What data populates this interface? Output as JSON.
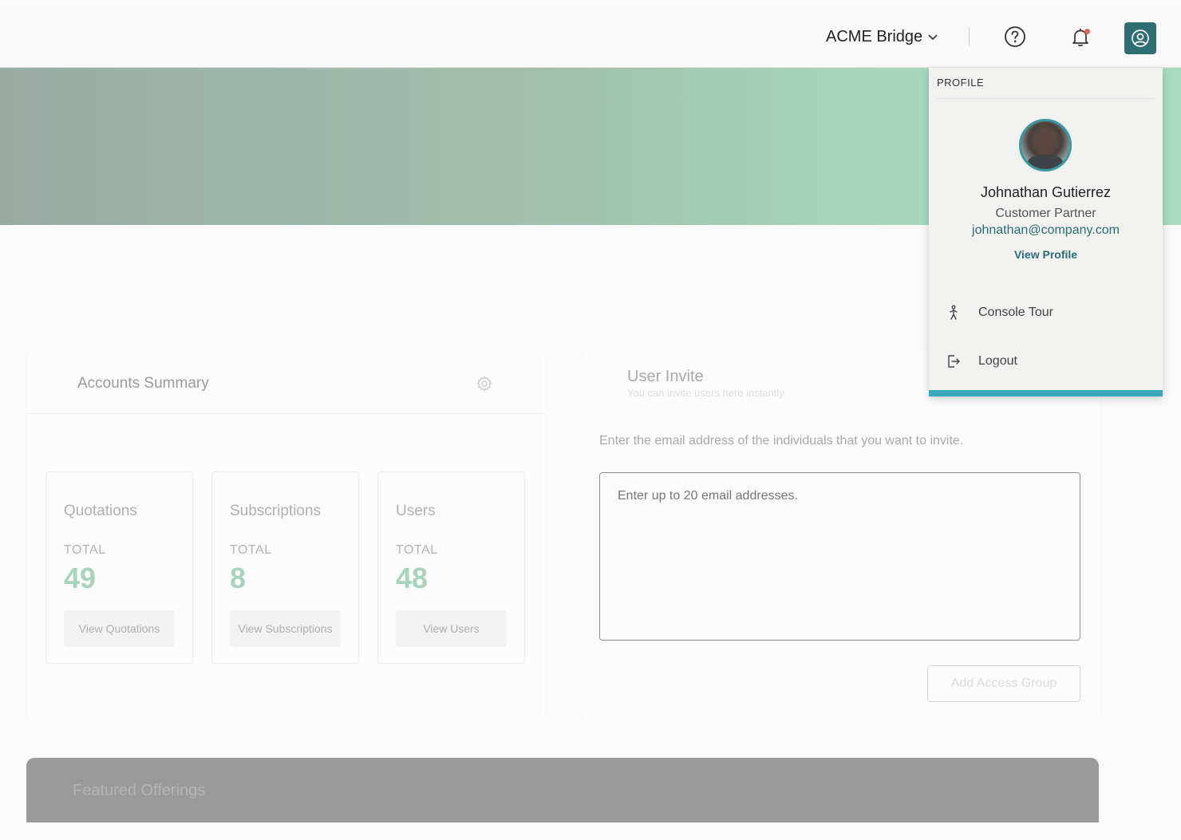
{
  "header": {
    "org_name": "ACME Bridge",
    "icons": {
      "org_dropdown": "chevron-down-icon",
      "help": "help-circle-icon",
      "notifications": "bell-icon",
      "profile": "user-circle-icon"
    },
    "colors": {
      "profile_button": "#2e6e73",
      "notification_dot": "#d9674f"
    }
  },
  "banner": {
    "gradient_colors": [
      "#9aaba4",
      "#a8dcc2"
    ]
  },
  "accounts_summary": {
    "title": "Accounts Summary",
    "settings_icon": "gear-icon",
    "stats": [
      {
        "title": "Quotations",
        "label": "TOTAL",
        "value": "49",
        "button": "View Quotations"
      },
      {
        "title": "Subscriptions",
        "label": "TOTAL",
        "value": "8",
        "button": "View Subscriptions"
      },
      {
        "title": "Users",
        "label": "TOTAL",
        "value": "48",
        "button": "View Users"
      }
    ],
    "accent_color": "#a8d3bd"
  },
  "user_invite": {
    "title": "User Invite",
    "subtitle": "You can invite users here instantly",
    "description": "Enter the email address of the individuals that you want to invite.",
    "email_placeholder": "Enter up to 20 email addresses.",
    "email_value": "",
    "add_access_group_label": "Add Access Group"
  },
  "featured": {
    "title": "Featured Offerings"
  },
  "profile_menu": {
    "header": "PROFILE",
    "name": "Johnathan Gutierrez",
    "role": "Customer Partner",
    "email": "johnathan@company.com",
    "view_profile": "View Profile",
    "items": [
      {
        "label": "Console Tour",
        "icon": "walking-person-icon"
      },
      {
        "label": "Logout",
        "icon": "logout-icon"
      }
    ],
    "colors": {
      "link": "#2b6d72",
      "footer_bar": "#3aa7bc"
    }
  }
}
